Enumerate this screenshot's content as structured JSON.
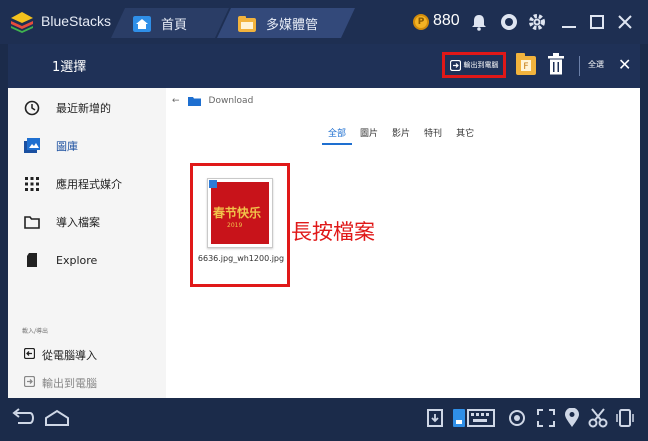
{
  "titlebar": {
    "app_name": "BlueStacks",
    "tabs": [
      {
        "label": "首頁",
        "icon": "home-icon"
      },
      {
        "label": "多媒體管",
        "icon": "folder-icon"
      }
    ],
    "coins": "880",
    "coin_glyph": "P",
    "window_controls": [
      "bell-icon",
      "account-icon",
      "settings-icon",
      "minimize-icon",
      "maximize-icon",
      "close-icon"
    ]
  },
  "toolbar": {
    "title": "1選擇",
    "export_label": "輸出到電腦",
    "select_all_label": "全選",
    "close_glyph": "✕",
    "folder_badge": "F"
  },
  "sidebar": {
    "items": [
      {
        "label": "最近新增的",
        "icon": "clock-icon",
        "active": false
      },
      {
        "label": "圖庫",
        "icon": "gallery-icon",
        "active": true
      },
      {
        "label": "應用程式媒介",
        "icon": "apps-grid-icon",
        "active": false
      },
      {
        "label": "導入檔案",
        "icon": "folder-outline-icon",
        "active": false
      },
      {
        "label": "Explore",
        "icon": "sd-card-icon",
        "active": false
      }
    ],
    "section_label": "載入/導出",
    "import_export": [
      {
        "label": "從電腦導入",
        "icon": "import-icon",
        "dim": false
      },
      {
        "label": "輸出到電腦",
        "icon": "export-icon",
        "dim": true
      }
    ]
  },
  "main": {
    "breadcrumb": {
      "back": "←",
      "folder": "Download"
    },
    "filters": [
      "全部",
      "圖片",
      "影片",
      "特刊",
      "其它"
    ],
    "active_filter": 0,
    "file": {
      "name": "6636.jpg_wh1200.jpg",
      "thumb_text": "春节快乐",
      "thumb_year": "2019"
    },
    "annotation": "長按檔案"
  },
  "colors": {
    "titlebar": "#1e2f52",
    "toolbar": "#1f3157",
    "accent": "#1e6fd0",
    "highlight": "#e01818"
  }
}
